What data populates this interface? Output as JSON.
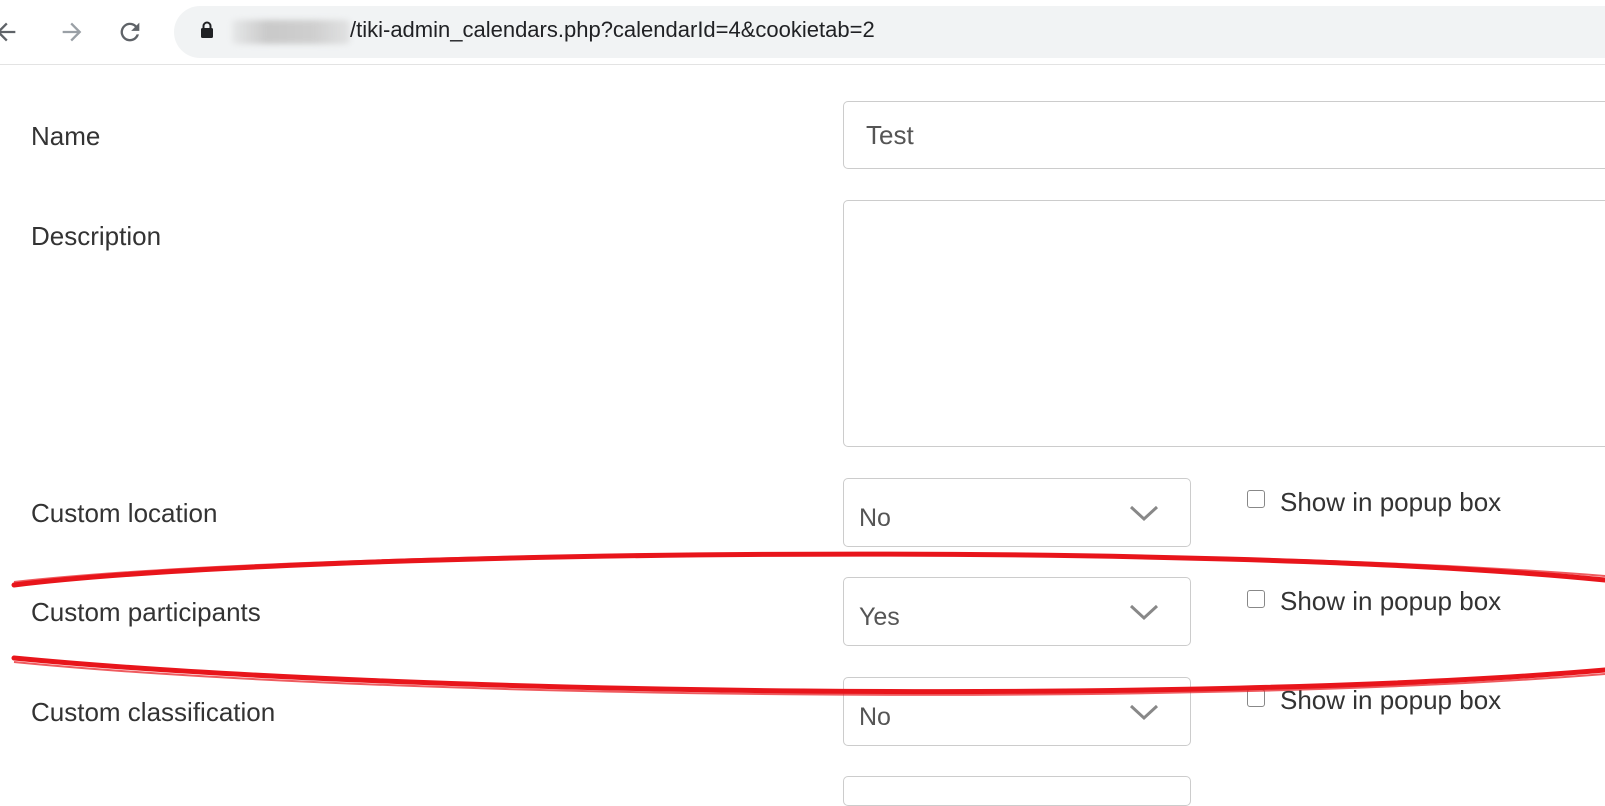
{
  "browser": {
    "url_path": "/tiki-admin_calendars.php?calendarId=4&cookietab=2"
  },
  "form": {
    "name": {
      "label": "Name",
      "value": "Test"
    },
    "description": {
      "label": "Description",
      "value": ""
    },
    "custom_location": {
      "label": "Custom location",
      "selected": "No",
      "checkbox_label": "Show in popup box",
      "checked": false
    },
    "custom_participants": {
      "label": "Custom participants",
      "selected": "Yes",
      "checkbox_label": "Show in popup box",
      "checked": false
    },
    "custom_classification": {
      "label": "Custom classification",
      "selected": "No",
      "checkbox_label": "Show in popup box",
      "checked": false
    }
  },
  "icons": [
    "back-icon",
    "forward-icon",
    "reload-icon",
    "lock-icon",
    "chevron-down-icon"
  ],
  "colors": {
    "annotation": "#e8151b",
    "border": "#cccccc",
    "omnibox": "#f1f3f4"
  }
}
